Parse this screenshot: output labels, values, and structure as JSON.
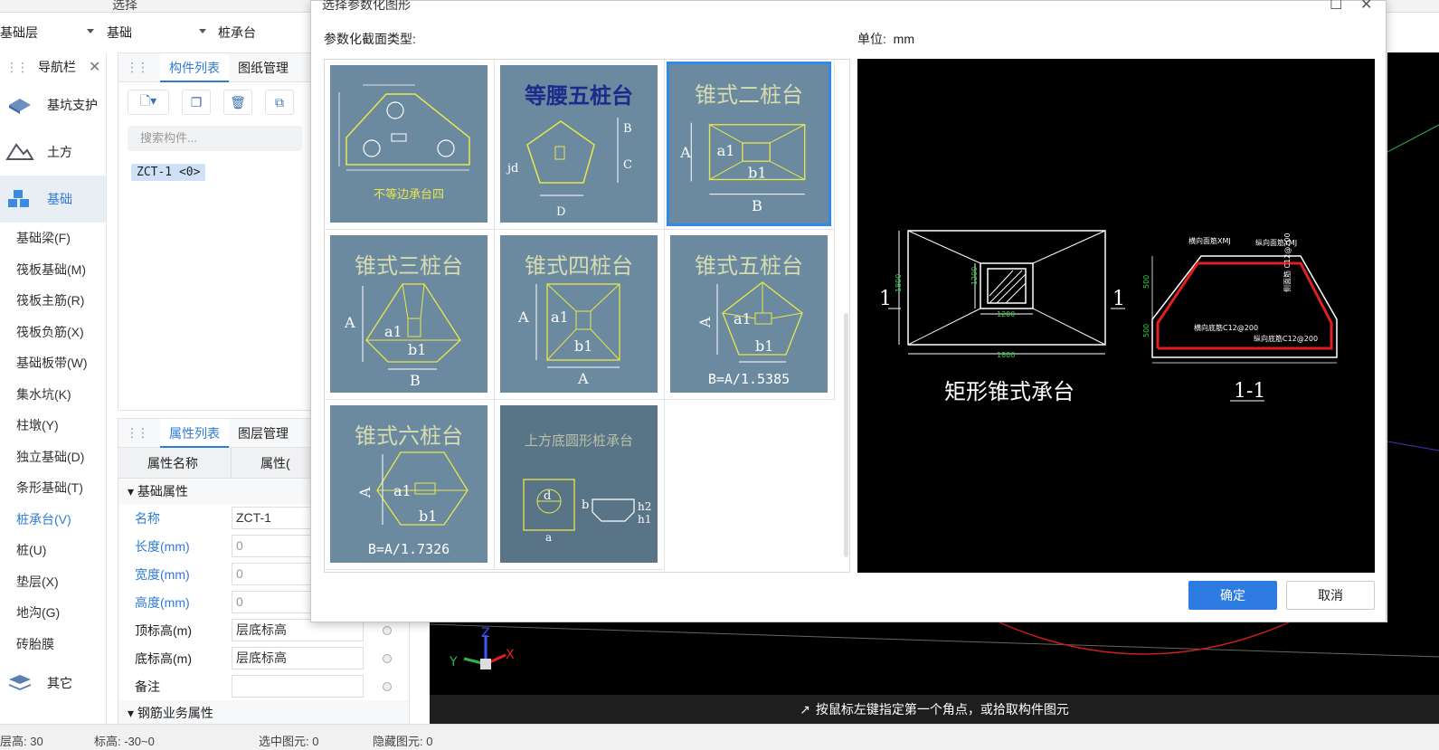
{
  "topbar": {
    "label": "选择"
  },
  "combos": [
    "基础层",
    "基础",
    "桩承台"
  ],
  "nav": {
    "title": "导航栏",
    "categories": [
      {
        "label": "基坑支护"
      },
      {
        "label": "土方"
      },
      {
        "label": "基础"
      }
    ],
    "items": [
      "基础梁(F)",
      "筏板基础(M)",
      "筏板主筋(R)",
      "筏板负筋(X)",
      "基础板带(W)",
      "集水坑(K)",
      "柱墩(Y)",
      "独立基础(D)",
      "条形基础(T)",
      "桩承台(V)",
      "桩(U)",
      "垫层(X)",
      "地沟(G)",
      "砖胎膜"
    ],
    "other": "其它"
  },
  "component_panel": {
    "tabs": [
      "构件列表",
      "图纸管理"
    ],
    "search_placeholder": "搜索构件...",
    "items": [
      "ZCT-1 <0>"
    ]
  },
  "property_panel": {
    "tabs": [
      "属性列表",
      "图层管理"
    ],
    "col_name": "属性名称",
    "col_value": "属性(",
    "group1": "基础属性",
    "rows": [
      {
        "k": "名称",
        "v": "ZCT-1"
      },
      {
        "k": "长度(mm)",
        "v": "0"
      },
      {
        "k": "宽度(mm)",
        "v": "0"
      },
      {
        "k": "高度(mm)",
        "v": "0"
      },
      {
        "k": "顶标高(m)",
        "v": "层底标高"
      },
      {
        "k": "底标高(m)",
        "v": "层底标高"
      },
      {
        "k": "备注",
        "v": ""
      }
    ],
    "group2": "钢筋业务属性"
  },
  "dialog": {
    "title": "选择参数化图形",
    "section_label": "参数化截面类型:",
    "unit_label": "单位:",
    "unit_value": "mm",
    "tiles": [
      {
        "title": "不等边承台四"
      },
      {
        "title": "等腰五桩台"
      },
      {
        "title": "锥式二桩台"
      },
      {
        "title": "锥式三桩台"
      },
      {
        "title": "锥式四桩台"
      },
      {
        "title": "锥式五桩台",
        "note": "B=A/1.5385"
      },
      {
        "title": "锥式六桩台",
        "note": "B=A/1.7326"
      },
      {
        "title": "上方底圆形桩承台"
      }
    ],
    "preview": {
      "plan_caption": "矩形锥式承台",
      "section_caption": "1-1",
      "dim_1800": "1800",
      "dim_1200": "1200",
      "dim_500": "500",
      "label_hj": "横向面筋XMJ",
      "label_zj": "纵向面筋YMJ",
      "label_hd": "横向底筋C12@200",
      "label_zd": "纵向底筋C12@200",
      "label_cbj": "侧面筋 C12@200",
      "section_mark": "1"
    },
    "ok": "确定",
    "cancel": "取消"
  },
  "status": {
    "hint": "按鼠标左键指定第一个角点，或拾取构件图元",
    "bottom": [
      "层高: 30",
      "标高: -30~0",
      "选中图元: 0",
      "隐藏图元: 0"
    ]
  }
}
